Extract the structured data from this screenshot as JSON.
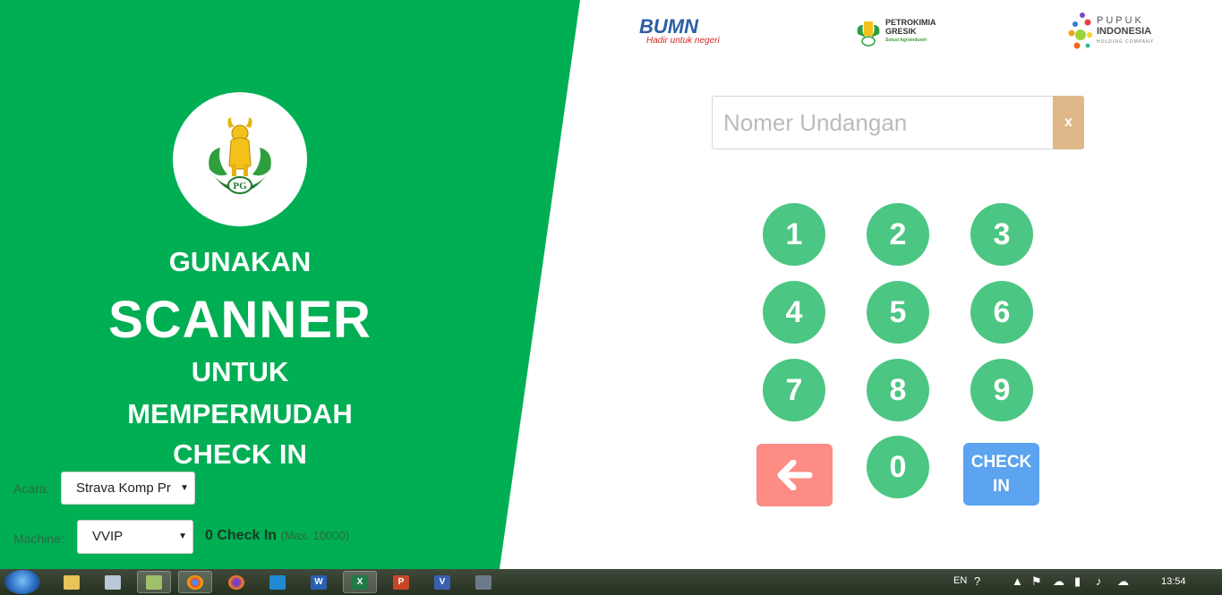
{
  "headline": {
    "line1": "GUNAKAN",
    "line2": "SCANNER",
    "line3": "UNTUK",
    "line4": "MEMPERMUDAH",
    "line5": "CHECK IN"
  },
  "form": {
    "event_label": "Acara:",
    "event_value": "Strava Komp Pr",
    "machine_label": "Machine:",
    "machine_value": "VVIP",
    "checkin_count": "0 Check In",
    "checkin_max": "(Max. 10000)"
  },
  "logos": {
    "bumn": "BUMN",
    "bumn_tagline": "Hadir untuk negeri",
    "petro_line1": "PETROKIMIA",
    "petro_line2": "GRESIK",
    "petro_tagline": "Solusi Agroindustri",
    "pupuk_line1": "PUPUK",
    "pupuk_line2": "INDONESIA",
    "pupuk_line3": "HOLDING COMPANY",
    "pg_mark": "PG"
  },
  "input": {
    "placeholder": "Nomer Undangan",
    "clear_label": "x"
  },
  "keypad": {
    "keys": [
      "1",
      "2",
      "3",
      "4",
      "5",
      "6",
      "7",
      "8",
      "9",
      "0"
    ],
    "checkin_line1": "CHECK",
    "checkin_line2": "IN"
  },
  "taskbar": {
    "language": "EN",
    "clock": "13:54",
    "apps": [
      "file-explorer",
      "calculator",
      "photos",
      "chrome",
      "firefox",
      "vscode",
      "word",
      "excel",
      "powerpoint",
      "visio",
      "other"
    ]
  },
  "colors": {
    "green": "#00ae53",
    "key_green": "#4cc683",
    "back_red": "#fc8c84",
    "checkin_blue": "#5ca3f0",
    "clear_tan": "#dfb889"
  }
}
